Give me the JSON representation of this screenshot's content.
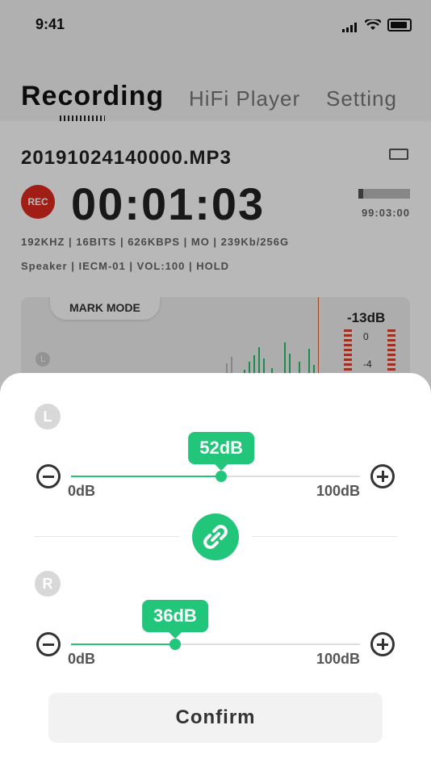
{
  "status_bar": {
    "time": "9:41"
  },
  "tabs": [
    {
      "label": "Recording",
      "active": true
    },
    {
      "label": "HiFi Player",
      "active": false
    },
    {
      "label": "Setting",
      "active": false
    }
  ],
  "recording": {
    "file_name": "20191024140000.MP3",
    "rec_badge": "REC",
    "timer": "00:01:03",
    "remaining": "99:03:00",
    "info_line1": "192KHZ | 16BITS | 626KBPS | MO | 239Kb/256G",
    "info_line2": "Speaker | IECM-01 | VOL:100 | HOLD"
  },
  "meter": {
    "mark_mode": "MARK MODE",
    "channel": "L",
    "level": "-13dB",
    "ticks": [
      "0",
      "-4"
    ]
  },
  "sheet": {
    "left_channel": {
      "label": "L",
      "value_label": "52dB",
      "value": 52,
      "min_label": "0dB",
      "max_label": "100dB"
    },
    "right_channel": {
      "label": "R",
      "value_label": "36dB",
      "value": 36,
      "min_label": "0dB",
      "max_label": "100dB"
    },
    "confirm_label": "Confirm"
  },
  "colors": {
    "accent": "#22c67a",
    "rec": "#e02a1f"
  },
  "icons": [
    "signal-icon",
    "wifi-icon",
    "battery-icon",
    "minus-icon",
    "plus-icon",
    "link-icon"
  ]
}
